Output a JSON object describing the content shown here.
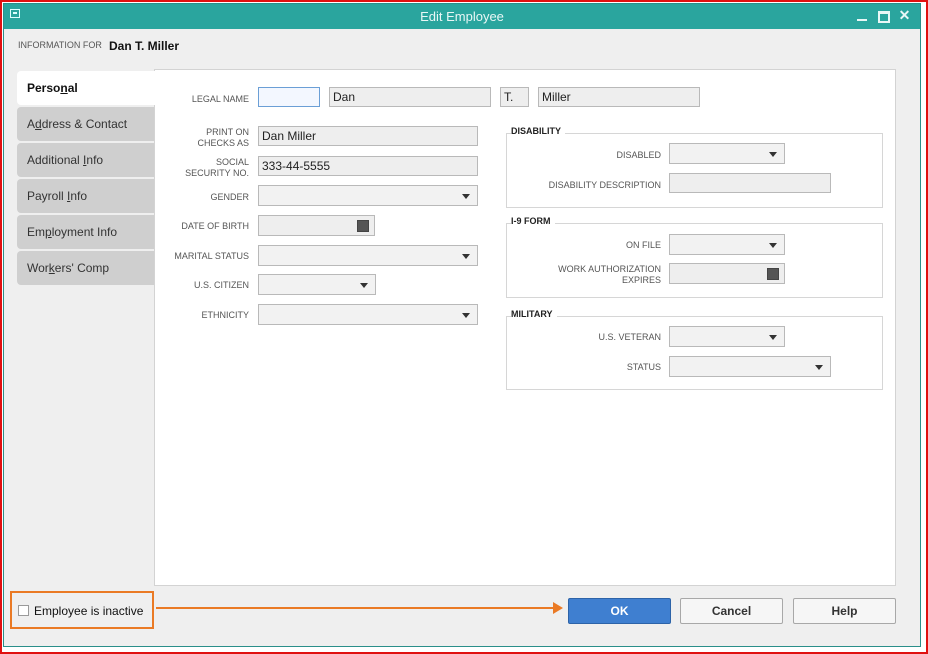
{
  "window": {
    "title": "Edit Employee",
    "info_for_label": "INFORMATION FOR",
    "employee_name": "Dan T. Miller"
  },
  "tabs": [
    {
      "label_pre": "Perso",
      "label_u": "n",
      "label_post": "al",
      "active": true
    },
    {
      "label_pre": "A",
      "label_u": "d",
      "label_post": "dress & Contact",
      "active": false
    },
    {
      "label_pre": "Additional ",
      "label_u": "I",
      "label_post": "nfo",
      "active": false
    },
    {
      "label_pre": "Payroll ",
      "label_u": "I",
      "label_post": "nfo",
      "active": false
    },
    {
      "label_pre": "Em",
      "label_u": "p",
      "label_post": "loyment Info",
      "active": false
    },
    {
      "label_pre": "Wor",
      "label_u": "k",
      "label_post": "ers' Comp",
      "active": false
    }
  ],
  "personal": {
    "legal_name_label": "LEGAL NAME",
    "legal_name": {
      "prefix": "",
      "first": "Dan",
      "middle": "T.",
      "last": "Miller"
    },
    "print_on_checks_label_1": "PRINT ON",
    "print_on_checks_label_2": "CHECKS AS",
    "print_on_checks": "Dan Miller",
    "ssn_label_1": "SOCIAL",
    "ssn_label_2": "SECURITY NO.",
    "ssn": "333-44-5555",
    "gender_label": "GENDER",
    "gender": "",
    "dob_label": "DATE OF BIRTH",
    "dob": "",
    "marital_status_label": "MARITAL STATUS",
    "marital_status": "",
    "us_citizen_label": "U.S. CITIZEN",
    "us_citizen": "",
    "ethnicity_label": "ETHNICITY",
    "ethnicity": ""
  },
  "disability": {
    "title": "DISABILITY",
    "disabled_label": "DISABLED",
    "disabled": "",
    "description_label": "DISABILITY DESCRIPTION",
    "description": ""
  },
  "i9": {
    "title": "I-9 FORM",
    "on_file_label": "ON FILE",
    "on_file": "",
    "work_auth_label_1": "WORK AUTHORIZATION",
    "work_auth_label_2": "EXPIRES",
    "work_auth_expires": ""
  },
  "military": {
    "title": "MILITARY",
    "veteran_label": "U.S. VETERAN",
    "veteran": "",
    "status_label": "STATUS",
    "status": ""
  },
  "footer": {
    "inactive_label": "Employee is inactive",
    "inactive_checked": false,
    "ok_label": "OK",
    "cancel_label": "Cancel",
    "help_label": "Help"
  },
  "colors": {
    "titlebar": "#2aa59e",
    "ok_button": "#3f7fd0",
    "annotation": "#ea7a25",
    "outer_border": "#e01010"
  }
}
